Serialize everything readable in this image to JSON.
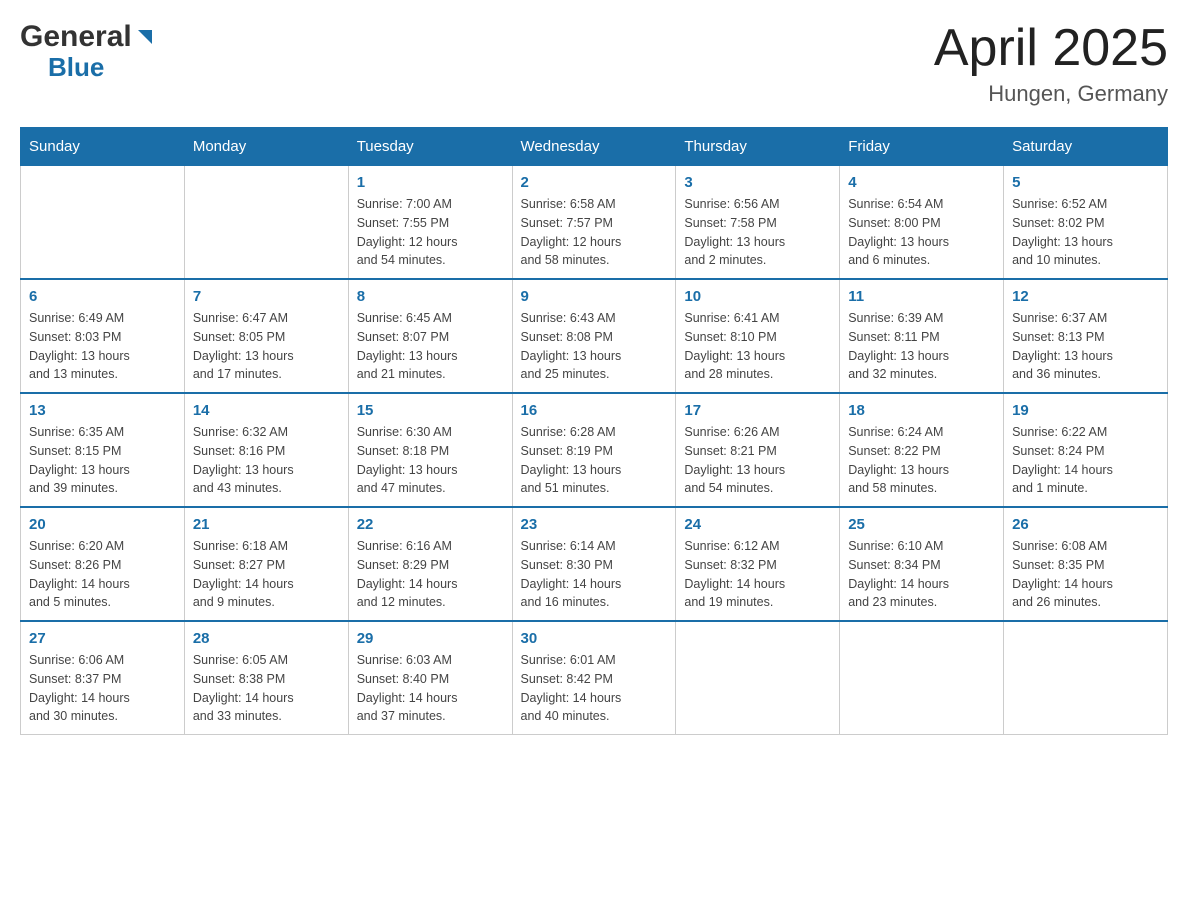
{
  "logo": {
    "general": "General",
    "blue": "Blue"
  },
  "header": {
    "title": "April 2025",
    "subtitle": "Hungen, Germany"
  },
  "weekdays": [
    "Sunday",
    "Monday",
    "Tuesday",
    "Wednesday",
    "Thursday",
    "Friday",
    "Saturday"
  ],
  "weeks": [
    [
      {
        "day": "",
        "info": ""
      },
      {
        "day": "",
        "info": ""
      },
      {
        "day": "1",
        "info": "Sunrise: 7:00 AM\nSunset: 7:55 PM\nDaylight: 12 hours\nand 54 minutes."
      },
      {
        "day": "2",
        "info": "Sunrise: 6:58 AM\nSunset: 7:57 PM\nDaylight: 12 hours\nand 58 minutes."
      },
      {
        "day": "3",
        "info": "Sunrise: 6:56 AM\nSunset: 7:58 PM\nDaylight: 13 hours\nand 2 minutes."
      },
      {
        "day": "4",
        "info": "Sunrise: 6:54 AM\nSunset: 8:00 PM\nDaylight: 13 hours\nand 6 minutes."
      },
      {
        "day": "5",
        "info": "Sunrise: 6:52 AM\nSunset: 8:02 PM\nDaylight: 13 hours\nand 10 minutes."
      }
    ],
    [
      {
        "day": "6",
        "info": "Sunrise: 6:49 AM\nSunset: 8:03 PM\nDaylight: 13 hours\nand 13 minutes."
      },
      {
        "day": "7",
        "info": "Sunrise: 6:47 AM\nSunset: 8:05 PM\nDaylight: 13 hours\nand 17 minutes."
      },
      {
        "day": "8",
        "info": "Sunrise: 6:45 AM\nSunset: 8:07 PM\nDaylight: 13 hours\nand 21 minutes."
      },
      {
        "day": "9",
        "info": "Sunrise: 6:43 AM\nSunset: 8:08 PM\nDaylight: 13 hours\nand 25 minutes."
      },
      {
        "day": "10",
        "info": "Sunrise: 6:41 AM\nSunset: 8:10 PM\nDaylight: 13 hours\nand 28 minutes."
      },
      {
        "day": "11",
        "info": "Sunrise: 6:39 AM\nSunset: 8:11 PM\nDaylight: 13 hours\nand 32 minutes."
      },
      {
        "day": "12",
        "info": "Sunrise: 6:37 AM\nSunset: 8:13 PM\nDaylight: 13 hours\nand 36 minutes."
      }
    ],
    [
      {
        "day": "13",
        "info": "Sunrise: 6:35 AM\nSunset: 8:15 PM\nDaylight: 13 hours\nand 39 minutes."
      },
      {
        "day": "14",
        "info": "Sunrise: 6:32 AM\nSunset: 8:16 PM\nDaylight: 13 hours\nand 43 minutes."
      },
      {
        "day": "15",
        "info": "Sunrise: 6:30 AM\nSunset: 8:18 PM\nDaylight: 13 hours\nand 47 minutes."
      },
      {
        "day": "16",
        "info": "Sunrise: 6:28 AM\nSunset: 8:19 PM\nDaylight: 13 hours\nand 51 minutes."
      },
      {
        "day": "17",
        "info": "Sunrise: 6:26 AM\nSunset: 8:21 PM\nDaylight: 13 hours\nand 54 minutes."
      },
      {
        "day": "18",
        "info": "Sunrise: 6:24 AM\nSunset: 8:22 PM\nDaylight: 13 hours\nand 58 minutes."
      },
      {
        "day": "19",
        "info": "Sunrise: 6:22 AM\nSunset: 8:24 PM\nDaylight: 14 hours\nand 1 minute."
      }
    ],
    [
      {
        "day": "20",
        "info": "Sunrise: 6:20 AM\nSunset: 8:26 PM\nDaylight: 14 hours\nand 5 minutes."
      },
      {
        "day": "21",
        "info": "Sunrise: 6:18 AM\nSunset: 8:27 PM\nDaylight: 14 hours\nand 9 minutes."
      },
      {
        "day": "22",
        "info": "Sunrise: 6:16 AM\nSunset: 8:29 PM\nDaylight: 14 hours\nand 12 minutes."
      },
      {
        "day": "23",
        "info": "Sunrise: 6:14 AM\nSunset: 8:30 PM\nDaylight: 14 hours\nand 16 minutes."
      },
      {
        "day": "24",
        "info": "Sunrise: 6:12 AM\nSunset: 8:32 PM\nDaylight: 14 hours\nand 19 minutes."
      },
      {
        "day": "25",
        "info": "Sunrise: 6:10 AM\nSunset: 8:34 PM\nDaylight: 14 hours\nand 23 minutes."
      },
      {
        "day": "26",
        "info": "Sunrise: 6:08 AM\nSunset: 8:35 PM\nDaylight: 14 hours\nand 26 minutes."
      }
    ],
    [
      {
        "day": "27",
        "info": "Sunrise: 6:06 AM\nSunset: 8:37 PM\nDaylight: 14 hours\nand 30 minutes."
      },
      {
        "day": "28",
        "info": "Sunrise: 6:05 AM\nSunset: 8:38 PM\nDaylight: 14 hours\nand 33 minutes."
      },
      {
        "day": "29",
        "info": "Sunrise: 6:03 AM\nSunset: 8:40 PM\nDaylight: 14 hours\nand 37 minutes."
      },
      {
        "day": "30",
        "info": "Sunrise: 6:01 AM\nSunset: 8:42 PM\nDaylight: 14 hours\nand 40 minutes."
      },
      {
        "day": "",
        "info": ""
      },
      {
        "day": "",
        "info": ""
      },
      {
        "day": "",
        "info": ""
      }
    ]
  ],
  "colors": {
    "header_bg": "#1a6ea8",
    "header_text": "#ffffff",
    "day_num_color": "#1a6ea8",
    "border_color": "#cccccc",
    "row_top_border": "#1a6ea8"
  }
}
